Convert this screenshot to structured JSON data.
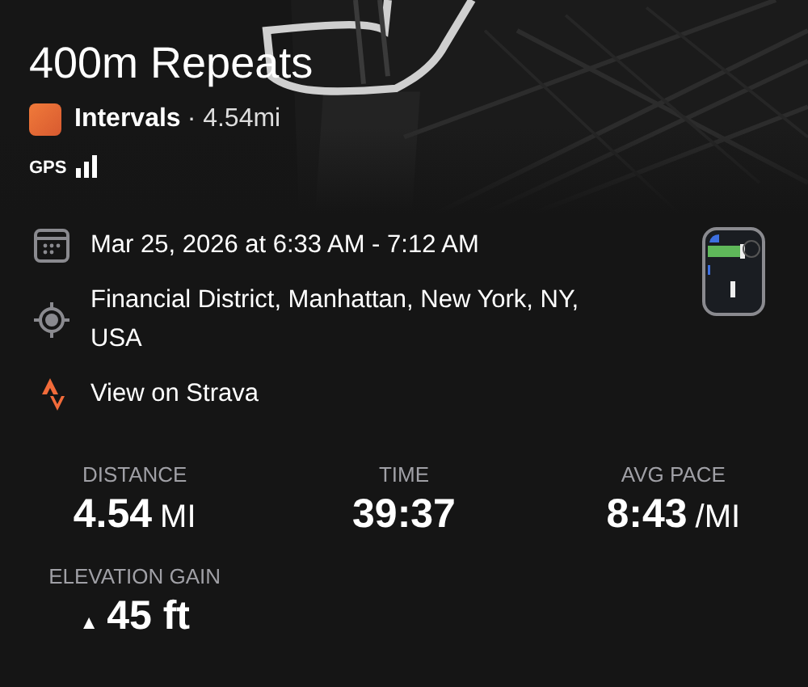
{
  "title": "400m Repeats",
  "activity": {
    "type": "Intervals",
    "detail": "· 4.54mi"
  },
  "gps": {
    "label": "GPS"
  },
  "details": [
    {
      "kind": "date",
      "text": "Mar 25, 2026 at 6:33 AM - 7:12 AM"
    },
    {
      "kind": "location",
      "text": "Financial District, Manhattan, New York, NY, USA"
    },
    {
      "kind": "strava",
      "text": "View on Strava"
    }
  ],
  "stats": [
    {
      "label": "DISTANCE",
      "value": "4.54",
      "unit": "MI"
    },
    {
      "label": "TIME",
      "value": "39:37"
    },
    {
      "label": "AVG PACE",
      "value": "8:43",
      "unit": "/MI"
    },
    {
      "label": "ELEVATION GAIN",
      "prefix": "▲",
      "value": "45 ft"
    }
  ]
}
